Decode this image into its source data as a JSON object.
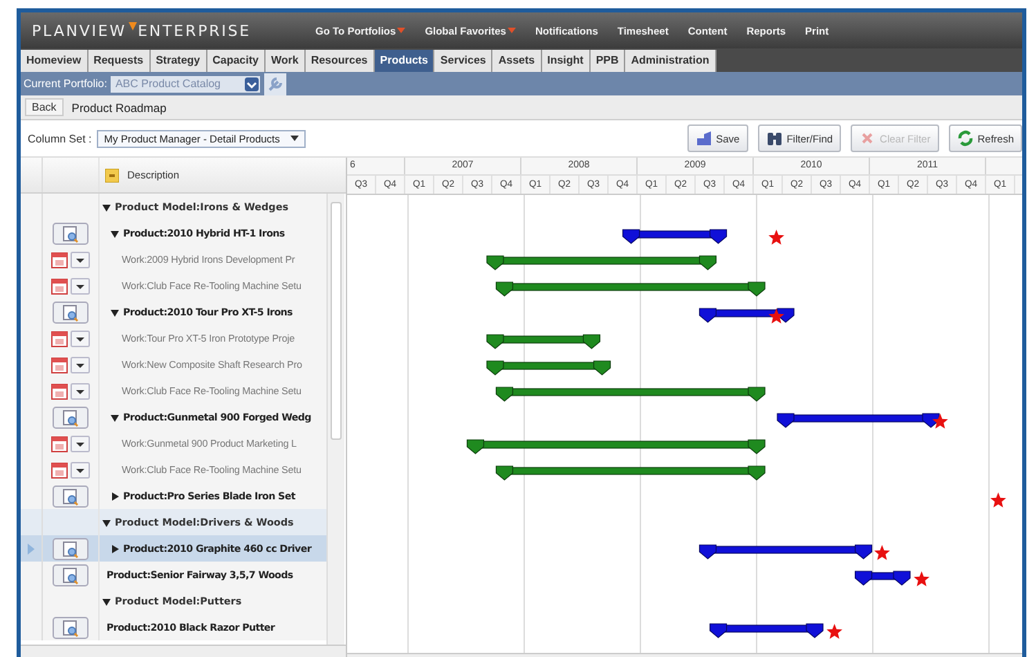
{
  "header": {
    "logo": "PLANVIEW",
    "logo_2": "ENTERPRISE",
    "links": [
      {
        "label": "Go To Portfolios",
        "menu": true
      },
      {
        "label": "Global Favorites",
        "menu": true
      },
      {
        "label": "Notifications",
        "menu": false
      },
      {
        "label": "Timesheet",
        "menu": false
      },
      {
        "label": "Content",
        "menu": false
      },
      {
        "label": "Reports",
        "menu": false
      },
      {
        "label": "Print",
        "menu": false
      }
    ]
  },
  "tabs": [
    {
      "label": "Homeview",
      "selected": false
    },
    {
      "label": "Requests",
      "selected": false
    },
    {
      "label": "Strategy",
      "selected": false
    },
    {
      "label": "Capacity",
      "selected": false
    },
    {
      "label": "Work",
      "selected": false
    },
    {
      "label": "Resources",
      "selected": false
    },
    {
      "label": "Products",
      "selected": true
    },
    {
      "label": "Services",
      "selected": false
    },
    {
      "label": "Assets",
      "selected": false
    },
    {
      "label": "Insight",
      "selected": false
    },
    {
      "label": "PPB",
      "selected": false
    },
    {
      "label": "Administration",
      "selected": false
    }
  ],
  "portfolio": {
    "label": "Current Portfolio:",
    "value": "ABC Product Catalog"
  },
  "breadcrumb": {
    "back": "Back",
    "title": "Product Roadmap"
  },
  "toolbar": {
    "column_set_label": "Column Set :",
    "column_set": "My Product Manager - Detail Products",
    "buttons": [
      {
        "kind": "save",
        "label": "Save",
        "disabled": false
      },
      {
        "kind": "filter",
        "label": "Filter/Find",
        "disabled": false
      },
      {
        "kind": "clear",
        "label": "Clear Filter",
        "disabled": true
      },
      {
        "kind": "refresh",
        "label": "Refresh",
        "disabled": false
      }
    ]
  },
  "grid": {
    "description_header": "Description",
    "years": [
      "6",
      "2007",
      "2008",
      "2009",
      "2010",
      "2011"
    ],
    "quarters": [
      "Q3",
      "Q4",
      "Q1",
      "Q2",
      "Q3",
      "Q4",
      "Q1",
      "Q2",
      "Q3",
      "Q4",
      "Q1",
      "Q2",
      "Q3",
      "Q4",
      "Q1",
      "Q2",
      "Q3",
      "Q4",
      "Q1",
      "Q2",
      "Q3",
      "Q4",
      "Q1"
    ],
    "rows": [
      {
        "kind": "model",
        "name": "Product Model:Irons & Wedges",
        "expanded": true,
        "selected": false,
        "children": [
          {
            "kind": "product",
            "name": "Product:2010 Hybrid HT-1 Irons",
            "expanded": true,
            "selected": false,
            "children": [
              {
                "kind": "work",
                "name": "Work:2009 Hybrid Irons Development Pr",
                "selected": false
              },
              {
                "kind": "work",
                "name": "Work:Club Face Re-Tooling Machine Setu",
                "selected": false
              }
            ]
          },
          {
            "kind": "product",
            "name": "Product:2010 Tour Pro XT-5 Irons",
            "expanded": true,
            "selected": false,
            "children": [
              {
                "kind": "work",
                "name": "Work:Tour Pro XT-5 Iron Prototype Proje",
                "selected": false
              },
              {
                "kind": "work",
                "name": "Work:New Composite Shaft Research Pro",
                "selected": false
              },
              {
                "kind": "work",
                "name": "Work:Club Face Re-Tooling Machine Setu",
                "selected": false
              }
            ]
          },
          {
            "kind": "product",
            "name": "Product:Gunmetal 900 Forged Wedg",
            "expanded": true,
            "selected": false,
            "children": [
              {
                "kind": "work",
                "name": "Work:Gunmetal 900 Product Marketing L",
                "selected": false
              },
              {
                "kind": "work",
                "name": "Work:Club Face Re-Tooling Machine Setu",
                "selected": false
              }
            ]
          },
          {
            "kind": "product",
            "name": "Product:Pro Series Blade Iron Set",
            "expanded": false,
            "selected": false
          }
        ]
      },
      {
        "kind": "model",
        "name": "Product Model:Drivers & Woods",
        "expanded": true,
        "selected": false,
        "children": [
          {
            "kind": "product",
            "name": "Product:2010 Graphite 460 cc Driver",
            "expanded": false,
            "selected": true
          },
          {
            "kind": "product",
            "name": "Product:Senior Fairway 3,5,7 Woods",
            "selected": false
          }
        ]
      },
      {
        "kind": "model",
        "name": "Product Model:Putters",
        "expanded": true,
        "selected": false,
        "children": [
          {
            "kind": "product",
            "name": "Product:2010 Black Razor Putter",
            "selected": false
          }
        ]
      }
    ]
  }
}
